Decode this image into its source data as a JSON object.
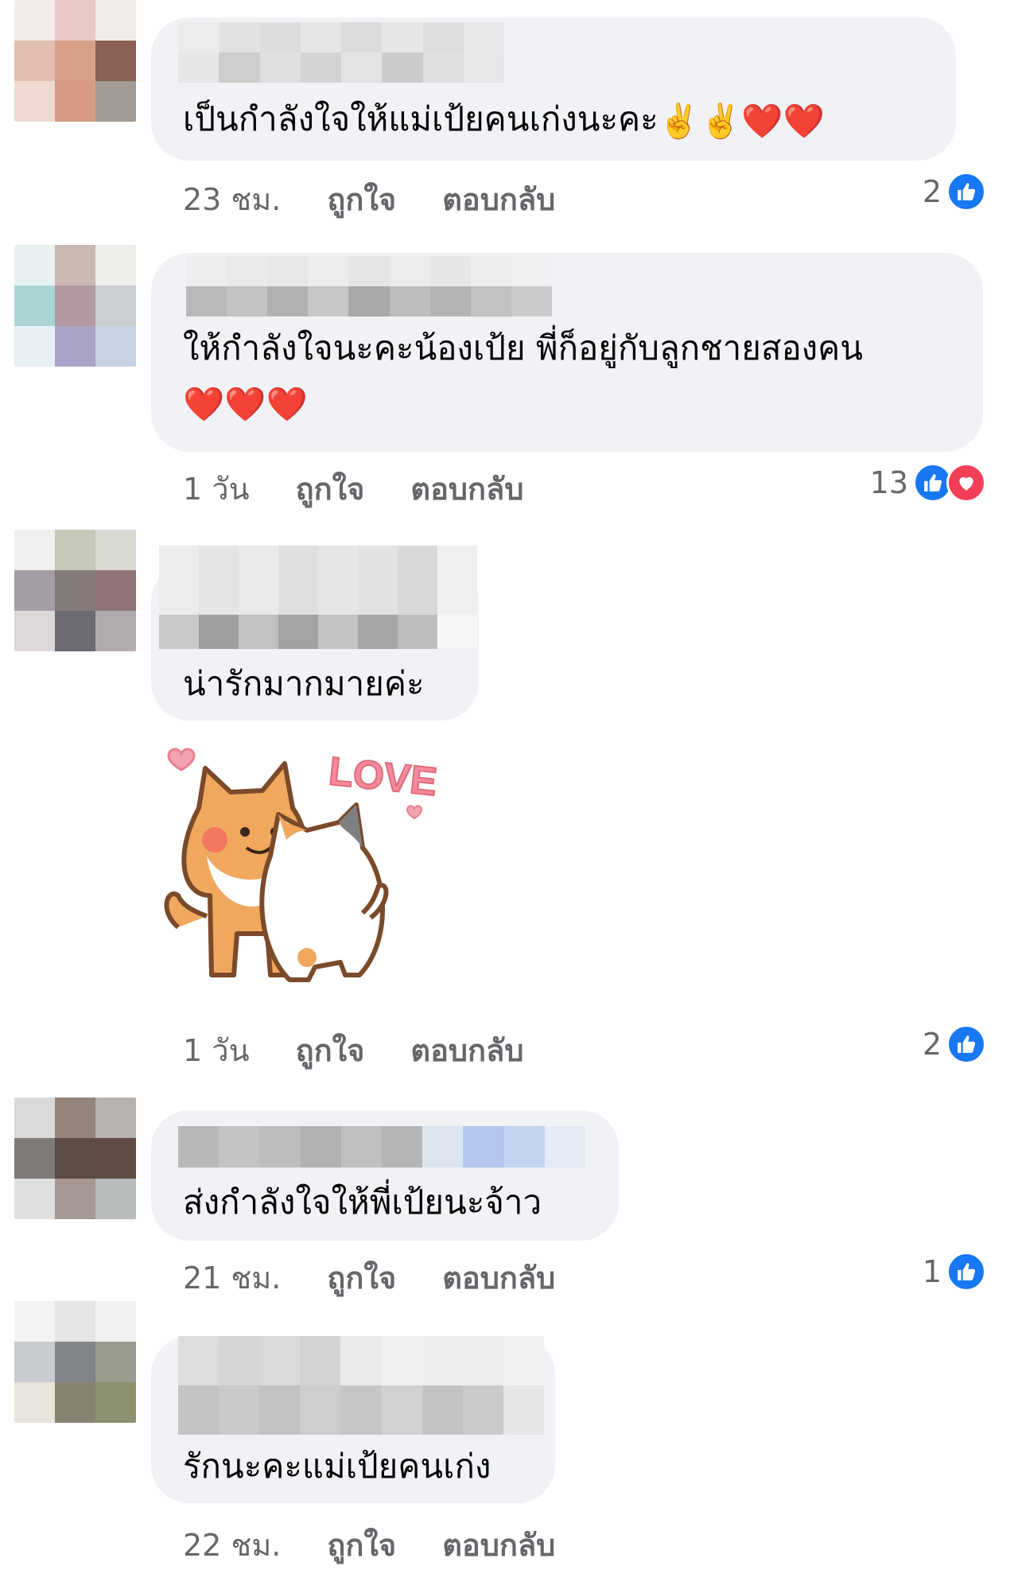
{
  "comments": [
    {
      "text": "เป็นกำลังใจให้แม่เป้ยคนเก่งนะคะ",
      "emojis": "✌️✌️❤️❤️",
      "time": "23 ชม.",
      "like_label": "ถูกใจ",
      "reply_label": "ตอบกลับ",
      "reaction_count": "2"
    },
    {
      "text_line1": "ให้กำลังใจนะคะน้องเป้ย พี่ก็อยู่กับลูกชายสองคน",
      "emojis": "❤️❤️❤️",
      "time": "1 วัน",
      "like_label": "ถูกใจ",
      "reply_label": "ตอบกลับ",
      "reaction_count": "13"
    },
    {
      "text": "น่ารักมากมายค่ะ",
      "sticker_text": "LOVE",
      "time": "1 วัน",
      "like_label": "ถูกใจ",
      "reply_label": "ตอบกลับ",
      "reaction_count": "2"
    },
    {
      "text": "ส่งกำลังใจให้พี่เป้ยนะจ้าว",
      "time": "21 ชม.",
      "like_label": "ถูกใจ",
      "reply_label": "ตอบกลับ",
      "reaction_count": "1"
    },
    {
      "text": "รักนะคะแม่เป้ยคนเก่ง",
      "time": "22 ชม.",
      "like_label": "ถูกใจ",
      "reply_label": "ตอบกลับ"
    }
  ],
  "icons": {
    "like": "thumbs-up-icon",
    "love": "heart-icon"
  },
  "colors": {
    "like": "#1877f2",
    "love": "#f33e58",
    "bubble": "#f0f2f5",
    "meta": "#65676b"
  }
}
